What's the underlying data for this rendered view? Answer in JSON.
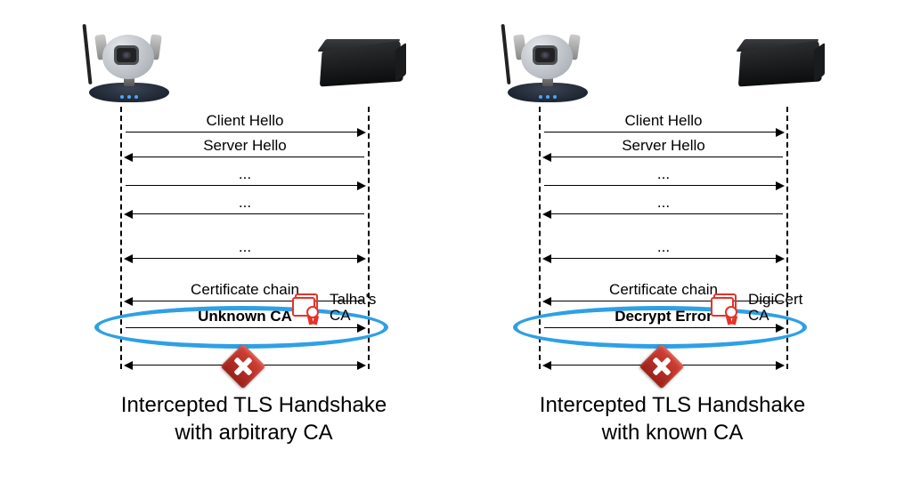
{
  "panels": [
    {
      "arrows": {
        "clientHello": "Client Hello",
        "serverHello": "Server Hello",
        "gap1": "...",
        "gap2": "...",
        "gap3": "...",
        "certChain": "Certificate chain",
        "result": "Unknown CA"
      },
      "ca": {
        "name": "Talha's\nCA"
      },
      "caption": "Intercepted TLS Handshake\nwith arbitrary CA"
    },
    {
      "arrows": {
        "clientHello": "Client Hello",
        "serverHello": "Server Hello",
        "gap1": "...",
        "gap2": "...",
        "gap3": "...",
        "certChain": "Certificate chain",
        "result": "Decrypt Error"
      },
      "ca": {
        "name": "DigiCert\nCA"
      },
      "caption": "Intercepted TLS Handshake\nwith known CA"
    }
  ]
}
